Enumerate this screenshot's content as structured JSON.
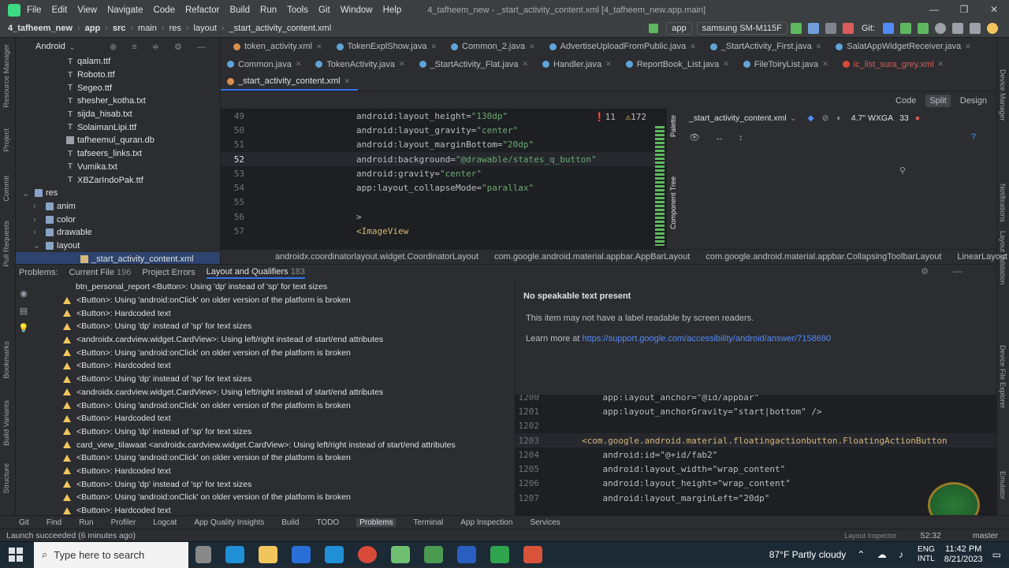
{
  "window": {
    "menu": [
      "File",
      "Edit",
      "View",
      "Navigate",
      "Code",
      "Refactor",
      "Build",
      "Run",
      "Tools",
      "Git",
      "Window",
      "Help"
    ],
    "title": "4_tafheem_new - _start_activity_content.xml [4_tafheem_new.app.main]"
  },
  "navbar": {
    "crumbs": [
      "4_tafheem_new",
      "app",
      "src",
      "main",
      "res",
      "layout",
      "_start_activity_content.xml"
    ],
    "run_config": "app",
    "device": "samsung SM-M115F",
    "git_label": "Git:"
  },
  "project": {
    "view": "Android",
    "items": [
      {
        "label": "qalam.ttf",
        "type": "T",
        "indent": 64
      },
      {
        "label": "Roboto.ttf",
        "type": "T",
        "indent": 64
      },
      {
        "label": "Segeo.ttf",
        "type": "T",
        "indent": 64
      },
      {
        "label": "shesher_kotha.txt",
        "type": "T",
        "indent": 64
      },
      {
        "label": "sijda_hisab.txt",
        "type": "T",
        "indent": 64
      },
      {
        "label": "SolaimanLipi.ttf",
        "type": "T",
        "indent": 64
      },
      {
        "label": "tafheemul_quran.db",
        "type": "db",
        "indent": 64
      },
      {
        "label": "tafseers_links.txt",
        "type": "T",
        "indent": 64
      },
      {
        "label": "Vumika.txt",
        "type": "T",
        "indent": 64
      },
      {
        "label": "XBZarIndoPak.ttf",
        "type": "T",
        "indent": 64
      },
      {
        "label": "res",
        "type": "folder",
        "indent": 22,
        "arrow": "⌄"
      },
      {
        "label": "anim",
        "type": "folder",
        "indent": 36,
        "arrow": "›"
      },
      {
        "label": "color",
        "type": "folder",
        "indent": 36,
        "arrow": "›"
      },
      {
        "label": "drawable",
        "type": "folder",
        "indent": 36,
        "arrow": "›"
      },
      {
        "label": "layout",
        "type": "folder",
        "indent": 36,
        "arrow": "⌄"
      },
      {
        "label": "_start_activity_content.xml",
        "type": "xml",
        "indent": 82
      }
    ]
  },
  "tabs": {
    "row1": [
      "token_activity.xml",
      "TokenExplShow.java",
      "Common_2.java",
      "AdvertiseUploadFromPublic.java",
      "_StartActivity_First.java",
      "SalatAppWidgetReceiver.java"
    ],
    "row2": [
      "Common.java",
      "TokenActivity.java",
      "_StartActivity_Flat.java",
      "Handler.java",
      "ReportBook_List.java",
      "FileToiryList.java",
      "ic_list_sura_grey.xml"
    ],
    "row3": [
      "_start_activity_content.xml"
    ]
  },
  "viewmodes": {
    "code": "Code",
    "split": "Split",
    "design": "Design"
  },
  "editor": {
    "errors": "11",
    "warnings": "172",
    "lines": [
      {
        "n": "49",
        "a": "android:layout_height=",
        "v": "\"130dp\""
      },
      {
        "n": "50",
        "a": "android:layout_gravity=",
        "v": "\"center\""
      },
      {
        "n": "51",
        "a": "android:layout_marginBottom=",
        "v": "\"20dp\""
      },
      {
        "n": "52",
        "a": "android:background=",
        "v": "\"@drawable/states_q_button\""
      },
      {
        "n": "53",
        "a": "android:gravity=",
        "v": "\"center\""
      },
      {
        "n": "54",
        "a": "app:layout_collapseMode=",
        "v": "\"parallax\""
      },
      {
        "n": "55",
        "a": "",
        "v": ""
      },
      {
        "n": "56",
        "a": ">",
        "v": ""
      },
      {
        "n": "57",
        "a": "<ImageView",
        "v": ""
      }
    ]
  },
  "design": {
    "file": "_start_activity_content.xml",
    "device": "4.7\" WXGA",
    "api": "33",
    "palette": "Palette",
    "component_tree": "Component Tree"
  },
  "breadcrumb": [
    "androidx.coordinatorlayout.widget.CoordinatorLayout",
    "com.google.android.material.appbar.AppBarLayout",
    "com.google.android.material.appbar.CollapsingToolbarLayout",
    "LinearLayout"
  ],
  "problems": {
    "tabs": [
      {
        "label": "Problems:",
        "count": ""
      },
      {
        "label": "Current File",
        "count": "196"
      },
      {
        "label": "Project Errors",
        "count": ""
      },
      {
        "label": "Layout and Qualifiers",
        "count": "183"
      }
    ],
    "items": [
      "btn_personal_report <Button>: Using 'dp' instead of 'sp' for text sizes",
      "<Button>: Using 'android:onClick' on older version of the platform is broken",
      "<Button>: Hardcoded text",
      "<Button>: Using 'dp' instead of 'sp' for text sizes",
      "<androidx.cardview.widget.CardView>: Using left/right instead of start/end attributes",
      "<Button>: Using 'android:onClick' on older version of the platform is broken",
      "<Button>: Hardcoded text",
      "<Button>: Using 'dp' instead of 'sp' for text sizes",
      "<androidx.cardview.widget.CardView>: Using left/right instead of start/end attributes",
      "<Button>: Using 'android:onClick' on older version of the platform is broken",
      "<Button>: Hardcoded text",
      "<Button>: Using 'dp' instead of 'sp' for text sizes",
      "card_view_tilawaat <androidx.cardview.widget.CardView>: Using left/right instead of start/end attributes",
      "<Button>: Using 'android:onClick' on older version of the platform is broken",
      "<Button>: Hardcoded text",
      "<Button>: Using 'dp' instead of 'sp' for text sizes",
      "<Button>: Using 'android:onClick' on older version of the platform is broken",
      "<Button>: Hardcoded text"
    ],
    "detail": {
      "title": "No speakable text present",
      "desc": "This item may not have a label readable by screen readers.",
      "learn": "Learn more at",
      "link": "https://support.google.com/accessibility/android/answer/7158690"
    },
    "code": [
      {
        "n": "1200",
        "t": "    app:layout_anchor=\"@id/appbar\""
      },
      {
        "n": "1201",
        "t": "    app:layout_anchorGravity=\"start|bottom\" />"
      },
      {
        "n": "1202",
        "t": ""
      },
      {
        "n": "1203",
        "t": "<com.google.android.material.floatingactionbutton.FloatingActionButton"
      },
      {
        "n": "1204",
        "t": "    android:id=\"@+id/fab2\""
      },
      {
        "n": "1205",
        "t": "    android:layout_width=\"wrap_content\""
      },
      {
        "n": "1206",
        "t": "    android:layout_height=\"wrap_content\""
      },
      {
        "n": "1207",
        "t": "    android:layout_marginLeft=\"20dp\""
      }
    ]
  },
  "toolwindows": [
    "Git",
    "Find",
    "Run",
    "Profiler",
    "Logcat",
    "App Quality Insights",
    "Build",
    "TODO",
    "Problems",
    "Terminal",
    "App Inspection",
    "Services"
  ],
  "left_strip": [
    "Resource Manager",
    "Project",
    "Commit",
    "Pull Requests",
    "Bookmarks",
    "Build Variants",
    "Structure"
  ],
  "right_strip": [
    "Device Manager",
    "Notifications",
    "Layout Validation",
    "Device File Explorer",
    "Emulator"
  ],
  "status": {
    "message": "Launch succeeded (6 minutes ago)",
    "position": "52:32",
    "branch": "master",
    "layout_inspector": "Layout Inspector"
  },
  "taskbar": {
    "search_placeholder": "Type here to search",
    "weather": "87°F  Partly cloudy",
    "lang1": "ENG",
    "lang2": "INTL",
    "time": "11:42 PM",
    "date": "8/21/2023"
  },
  "colors": {
    "accent": "#3574f0",
    "warning": "#f2c55c",
    "string": "#6aab73",
    "attr_ns": "#c77dbb"
  }
}
